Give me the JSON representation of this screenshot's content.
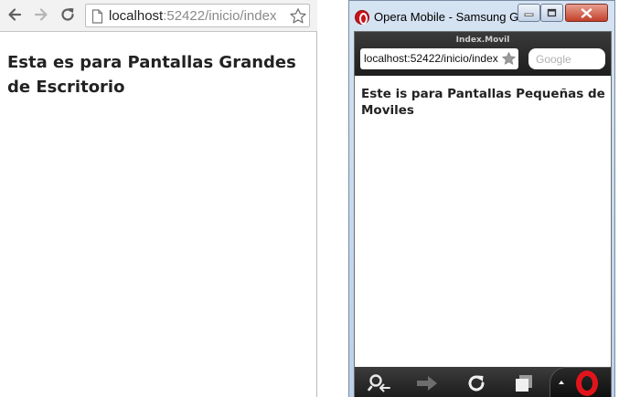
{
  "desktop_browser": {
    "url_host": "localhost",
    "url_rest": ":52422/inicio/index",
    "heading": "Esta es para Pantallas Grandes de Escritorio"
  },
  "opera_window": {
    "title": "Opera Mobile - Samsung G...",
    "page_title": "Index.Movil",
    "url": "localhost:52422/inicio/index",
    "search_placeholder": "Google",
    "heading": "Este is para Pantallas Pequeñas de Moviles"
  },
  "colors": {
    "opera_red": "#e2141b",
    "toolbar_dark": "#1e1e1e"
  },
  "icons": [
    "back-arrow-icon",
    "forward-arrow-icon",
    "reload-icon",
    "page-icon",
    "star-icon",
    "opera-icon",
    "minimize-icon",
    "maximize-icon",
    "close-icon",
    "zoom-out-icon",
    "reload-icon",
    "tabs-icon",
    "opera-logo-icon"
  ]
}
